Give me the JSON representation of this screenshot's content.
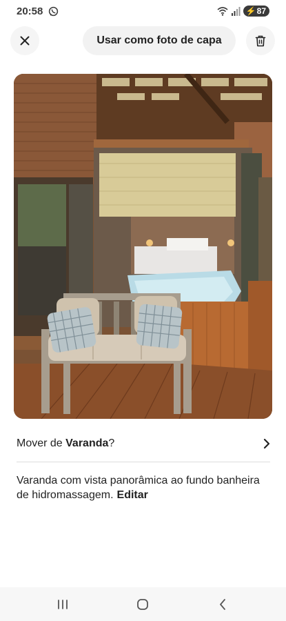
{
  "status_bar": {
    "time": "20:58",
    "battery": "87",
    "icons": [
      "whatsapp-icon",
      "wifi-icon",
      "signal-icon",
      "battery-icon"
    ]
  },
  "top_bar": {
    "close_icon": "close-icon",
    "cover_button_label": "Usar como foto de capa",
    "delete_icon": "trash-icon"
  },
  "photo": {
    "subject": "porch-with-bench-and-hot-tub"
  },
  "move": {
    "prefix": "Mover de ",
    "room": "Varanda",
    "suffix": "?",
    "chevron_icon": "chevron-right-icon"
  },
  "caption": {
    "text": "Varanda com vista panorâmica ao fundo banheira de hidromassagem.",
    "edit_label": "Editar"
  },
  "nav_bar": {
    "icons": [
      "recents-icon",
      "home-icon",
      "back-icon"
    ]
  },
  "colors": {
    "text": "#222222",
    "button_bg": "#f2f2f2",
    "divider": "#dddddd"
  }
}
